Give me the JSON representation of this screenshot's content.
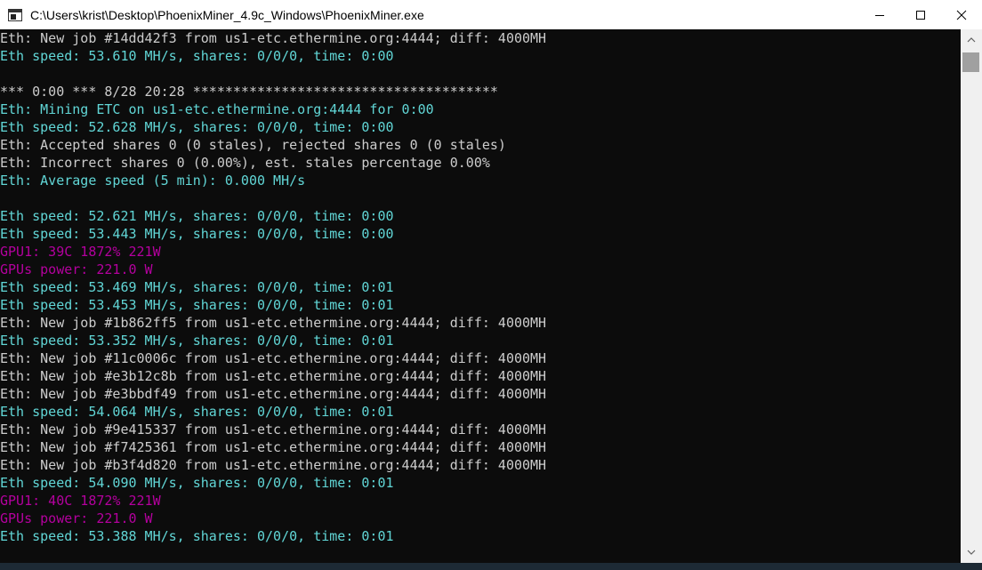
{
  "window": {
    "title": "C:\\Users\\krist\\Desktop\\PhoenixMiner_4.9c_Windows\\PhoenixMiner.exe"
  },
  "icons": {
    "app": "console-window-icon",
    "minimize": "minimize-icon",
    "maximize": "maximize-icon",
    "close": "close-icon",
    "scroll_up": "chevron-up-icon",
    "scroll_down": "chevron-down-icon"
  },
  "colors": {
    "background": "#0c0c0c",
    "default_text": "#cccccc",
    "info_text": "#61d6d6",
    "gpu_text": "#b4009e"
  },
  "console": {
    "lines": [
      {
        "text": "Eth: New job #14dd42f3 from us1-etc.ethermine.org:4444; diff: 4000MH",
        "color": "white"
      },
      {
        "text": "Eth speed: 53.610 MH/s, shares: 0/0/0, time: 0:00",
        "color": "cyan"
      },
      {
        "text": "",
        "color": "white"
      },
      {
        "text": "*** 0:00 *** 8/28 20:28 **************************************",
        "color": "white"
      },
      {
        "text": "Eth: Mining ETC on us1-etc.ethermine.org:4444 for 0:00",
        "color": "cyan"
      },
      {
        "text": "Eth speed: 52.628 MH/s, shares: 0/0/0, time: 0:00",
        "color": "cyan"
      },
      {
        "text": "Eth: Accepted shares 0 (0 stales), rejected shares 0 (0 stales)",
        "color": "white"
      },
      {
        "text": "Eth: Incorrect shares 0 (0.00%), est. stales percentage 0.00%",
        "color": "white"
      },
      {
        "text": "Eth: Average speed (5 min): 0.000 MH/s",
        "color": "cyan"
      },
      {
        "text": "",
        "color": "white"
      },
      {
        "text": "Eth speed: 52.621 MH/s, shares: 0/0/0, time: 0:00",
        "color": "cyan"
      },
      {
        "text": "Eth speed: 53.443 MH/s, shares: 0/0/0, time: 0:00",
        "color": "cyan"
      },
      {
        "text": "GPU1: 39C 1872% 221W",
        "color": "magenta"
      },
      {
        "text": "GPUs power: 221.0 W",
        "color": "magenta"
      },
      {
        "text": "Eth speed: 53.469 MH/s, shares: 0/0/0, time: 0:01",
        "color": "cyan"
      },
      {
        "text": "Eth speed: 53.453 MH/s, shares: 0/0/0, time: 0:01",
        "color": "cyan"
      },
      {
        "text": "Eth: New job #1b862ff5 from us1-etc.ethermine.org:4444; diff: 4000MH",
        "color": "white"
      },
      {
        "text": "Eth speed: 53.352 MH/s, shares: 0/0/0, time: 0:01",
        "color": "cyan"
      },
      {
        "text": "Eth: New job #11c0006c from us1-etc.ethermine.org:4444; diff: 4000MH",
        "color": "white"
      },
      {
        "text": "Eth: New job #e3b12c8b from us1-etc.ethermine.org:4444; diff: 4000MH",
        "color": "white"
      },
      {
        "text": "Eth: New job #e3bbdf49 from us1-etc.ethermine.org:4444; diff: 4000MH",
        "color": "white"
      },
      {
        "text": "Eth speed: 54.064 MH/s, shares: 0/0/0, time: 0:01",
        "color": "cyan"
      },
      {
        "text": "Eth: New job #9e415337 from us1-etc.ethermine.org:4444; diff: 4000MH",
        "color": "white"
      },
      {
        "text": "Eth: New job #f7425361 from us1-etc.ethermine.org:4444; diff: 4000MH",
        "color": "white"
      },
      {
        "text": "Eth: New job #b3f4d820 from us1-etc.ethermine.org:4444; diff: 4000MH",
        "color": "white"
      },
      {
        "text": "Eth speed: 54.090 MH/s, shares: 0/0/0, time: 0:01",
        "color": "cyan"
      },
      {
        "text": "GPU1: 40C 1872% 221W",
        "color": "magenta"
      },
      {
        "text": "GPUs power: 221.0 W",
        "color": "magenta"
      },
      {
        "text": "Eth speed: 53.388 MH/s, shares: 0/0/0, time: 0:01",
        "color": "cyan"
      }
    ]
  }
}
